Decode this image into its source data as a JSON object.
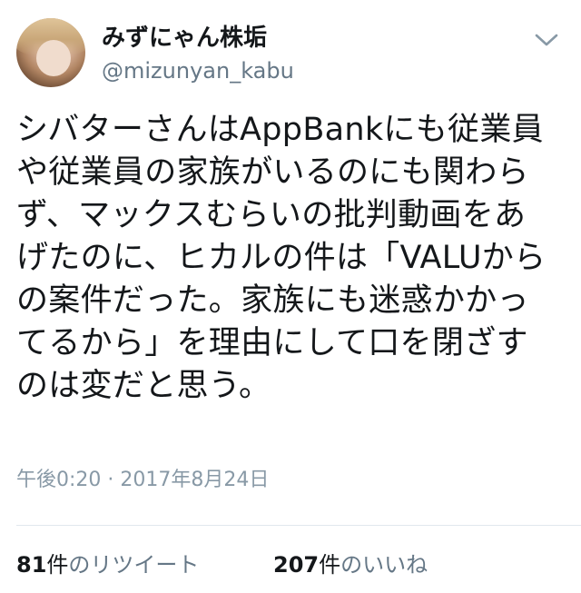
{
  "user": {
    "display_name": "みずにゃん株垢",
    "handle": "@mizunyan_kabu"
  },
  "tweet": {
    "lines": [
      "シバターさんはAppBankにも従業員",
      "や従業員の家族がいるのにも関わら",
      "ず、マックスむらいの批判動画をあ",
      "げたのに、ヒカルの件は「VALUから",
      "の案件だった。家族にも迷惑かかっ",
      "てるから」を理由にして口を閉ざす",
      "のは変だと思う。"
    ],
    "timestamp": "午後0:20 · 2017年8月24日"
  },
  "stats": {
    "retweets": {
      "count": "81",
      "unit": "件",
      "label": "のリツイート"
    },
    "likes": {
      "count": "207",
      "unit": "件",
      "label": "のいいね"
    }
  },
  "icons": {
    "menu": "chevron-down-icon",
    "avatar": "profile-avatar"
  },
  "colors": {
    "text": "#14171a",
    "secondary": "#657786",
    "timestamp": "#8899a6",
    "divider": "#e1e8ed"
  }
}
